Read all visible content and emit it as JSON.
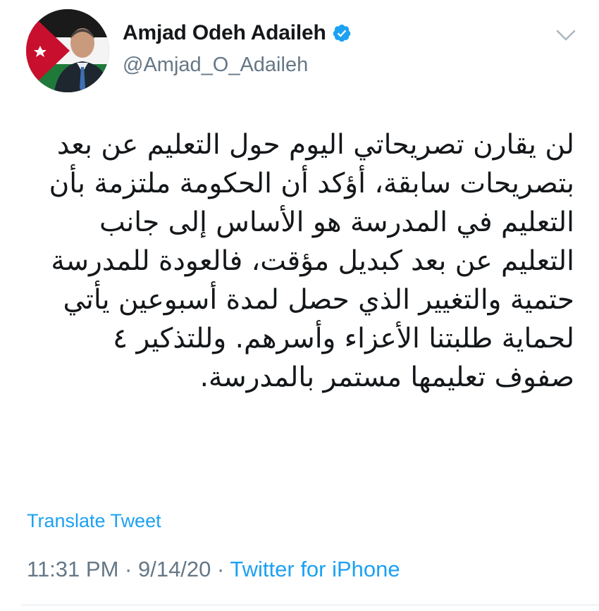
{
  "author": {
    "display_name": "Amjad Odeh Adaileh",
    "handle": "@Amjad_O_Adaileh",
    "verified": true,
    "avatar_icon": "profile-photo-with-jordan-flag"
  },
  "tweet": {
    "lines": [
      "لن يقارن تصريحاتي اليوم حول التعليم عن بعد",
      "بتصريحات سابقة، أؤكد أن الحكومة ملتزمة بأن",
      "التعليم في المدرسة هو الأساس إلى جانب",
      "التعليم عن بعد كبديل مؤقت، فالعودة للمدرسة",
      "حتمية والتغيير الذي حصل لمدة أسبوعين يأتي",
      "لحماية طلبتنا الأعزاء وأسرهم. وللتذكير ٤",
      "صفوف تعليمها مستمر بالمدرسة."
    ],
    "translate_label": "Translate Tweet",
    "time": "11:31 PM",
    "separator": "·",
    "date": "9/14/20",
    "source": "Twitter for iPhone"
  },
  "colors": {
    "link_blue": "#1da1f2",
    "muted_gray": "#657786",
    "text": "#14171a"
  },
  "icons": [
    "verified-badge-icon",
    "chevron-down-icon"
  ]
}
